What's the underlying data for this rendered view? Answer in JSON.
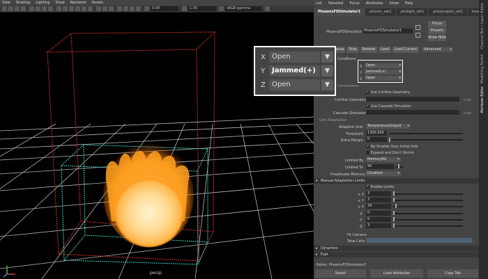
{
  "viewport": {
    "menu": [
      "View",
      "Shading",
      "Lighting",
      "Show",
      "Renderer",
      "Panels"
    ],
    "toolbar": {
      "value1": "0.00",
      "value2": "1.00",
      "color_space": "sRGB gamma"
    },
    "camera_label": "persp"
  },
  "editor": {
    "menu": [
      "List",
      "Selected",
      "Focus",
      "Attributes",
      "Show",
      "Help"
    ],
    "tabs": [
      "PhoenixFDSimulator1",
      "phxsim_set1",
      "phxlight_set1",
      "phoxscapes_set1",
      "base1"
    ],
    "node_label": "PhoenixFDSimulator:",
    "node_name": "PhoenixFDSimulator1",
    "focus_btn": "Focus",
    "presets_btn": "Presets",
    "show_btn": "Show",
    "hide_btn": "Hide",
    "sim_buttons": [
      "Pause",
      "Stop",
      "Restore",
      "Load",
      "Load Current"
    ],
    "advanced": "Advanced",
    "conditions_label": "Conditions",
    "axes": [
      {
        "axis": "X",
        "value": "Open"
      },
      {
        "axis": "Y",
        "value": "Jammed(+)"
      },
      {
        "axis": "Z",
        "value": "Open"
      }
    ],
    "connections_label": "Connections",
    "use_confine": "Use Confine Geometry",
    "confine_geometry": "Confine Geometry",
    "use_cascade": "Use Cascade Simulator",
    "cascade_simulator": "Cascade Simulator",
    "map_label": "map",
    "grid_adaptation": "Grid Adaptation",
    "adaptive_grid_label": "Adaptive Grid",
    "adaptive_grid_value": "Temperature/Liquid",
    "threshold_label": "Threshold",
    "threshold_value": "1300.000",
    "extra_margin_label": "Extra Margin",
    "extra_margin_value": "0",
    "no_smaller": "No Smaller than Initial Grid",
    "expand_no_shrink": "Expand and Don't Shrink",
    "limited_by_label": "Limited By",
    "limited_by_value": "MemoryRd",
    "limited_to_label": "Limited To",
    "limited_to_value": "90",
    "prealloc_label": "Preallocate Memory",
    "prealloc_value": "Disabled",
    "manual_limits": "Manual Adaptation Limits",
    "enable_limits": "Enable Limits",
    "limits": [
      {
        "label": "+ X",
        "value": "3"
      },
      {
        "label": "+ Y",
        "value": "3"
      },
      {
        "label": "+ Y",
        "value": "34"
      },
      {
        "label": "- X",
        "value": "0"
      },
      {
        "label": "- Y",
        "value": "0"
      },
      {
        "label": "- Z",
        "value": "3"
      }
    ],
    "fit_camera": "Fit Camera",
    "total_cells": "Total Cells",
    "dynamics": "Dynamics",
    "fuel": "Fuel",
    "notes": "Notes: PhoenixFDSimulator1",
    "bottom_buttons": [
      "Select",
      "Load Attributes",
      "Copy Tab"
    ]
  },
  "side_tabs": [
    "Channel Box / Layer Editor",
    "Modelling Toolkit",
    "Attribute Editor"
  ],
  "callout": {
    "axes": [
      {
        "axis": "X",
        "value": "Open"
      },
      {
        "axis": "Y",
        "value": "Jammed(+)"
      },
      {
        "axis": "Z",
        "value": "Open"
      }
    ]
  },
  "colors": {
    "accent_red": "#c83030",
    "accent_cyan": "#40d0c0",
    "fire": "#ffb030"
  }
}
